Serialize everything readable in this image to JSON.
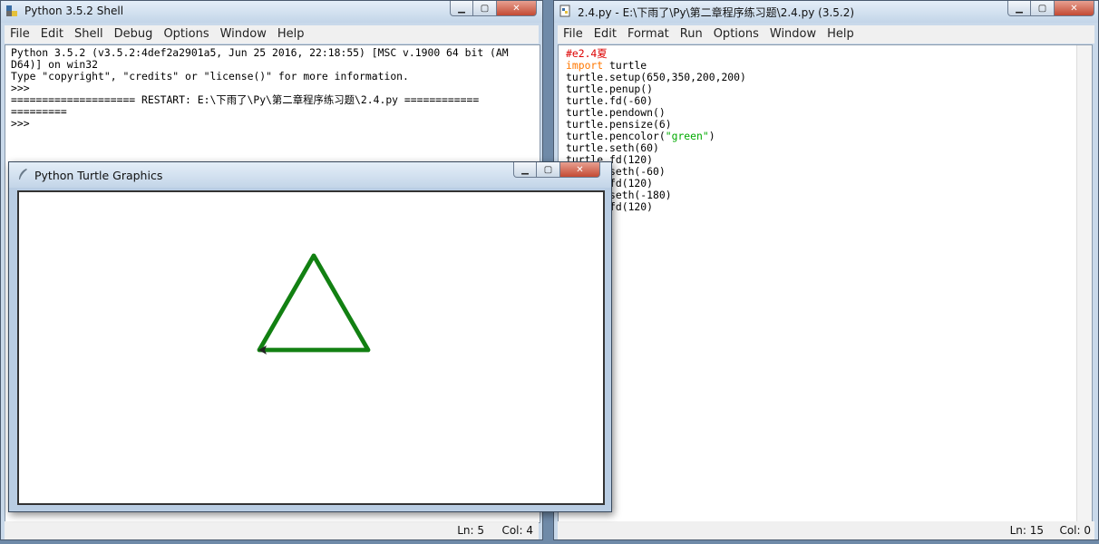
{
  "shell": {
    "title": "Python 3.5.2 Shell",
    "menu": [
      "File",
      "Edit",
      "Shell",
      "Debug",
      "Options",
      "Window",
      "Help"
    ],
    "lines": [
      "Python 3.5.2 (v3.5.2:4def2a2901a5, Jun 25 2016, 22:18:55) [MSC v.1900 64 bit (AM",
      "D64)] on win32",
      "Type \"copyright\", \"credits\" or \"license()\" for more information.",
      ">>> ",
      "==================== RESTART: E:\\下雨了\\Py\\第二章程序练习题\\2.4.py ============",
      "=========",
      ">>> "
    ],
    "status": {
      "ln": "Ln: 5",
      "col": "Col: 4"
    }
  },
  "editor": {
    "title": "2.4.py - E:\\下雨了\\Py\\第二章程序练习题\\2.4.py (3.5.2)",
    "menu": [
      "File",
      "Edit",
      "Format",
      "Run",
      "Options",
      "Window",
      "Help"
    ],
    "code": {
      "comment": "#e2.4夏",
      "import_kw": "import",
      "import_mod": " turtle",
      "setup": "turtle.setup(650,350,200,200)",
      "penup": "turtle.penup()",
      "fd1": "turtle.fd(-60)",
      "pendown": "turtle.pendown()",
      "pensize": "turtle.pensize(6)",
      "pencolor_pre": "turtle.pencolor(",
      "pencolor_str": "\"green\"",
      "pencolor_post": ")",
      "seth1": "turtle.seth(60)",
      "fd2": "turtle.fd(120)",
      "seth2": "turtle.seth(-60)",
      "fd3": "turtle.fd(120)",
      "seth3": "turtle.seth(-180)",
      "fd4": "turtle.fd(120)"
    },
    "status": {
      "ln": "Ln: 15",
      "col": "Col: 0"
    }
  },
  "turtle": {
    "title": "Python Turtle Graphics",
    "pen_color": "#128012",
    "pen_size": 6
  },
  "colors": {
    "keyword": "#ff7700",
    "comment": "#dd0000",
    "string": "#00aa00"
  }
}
